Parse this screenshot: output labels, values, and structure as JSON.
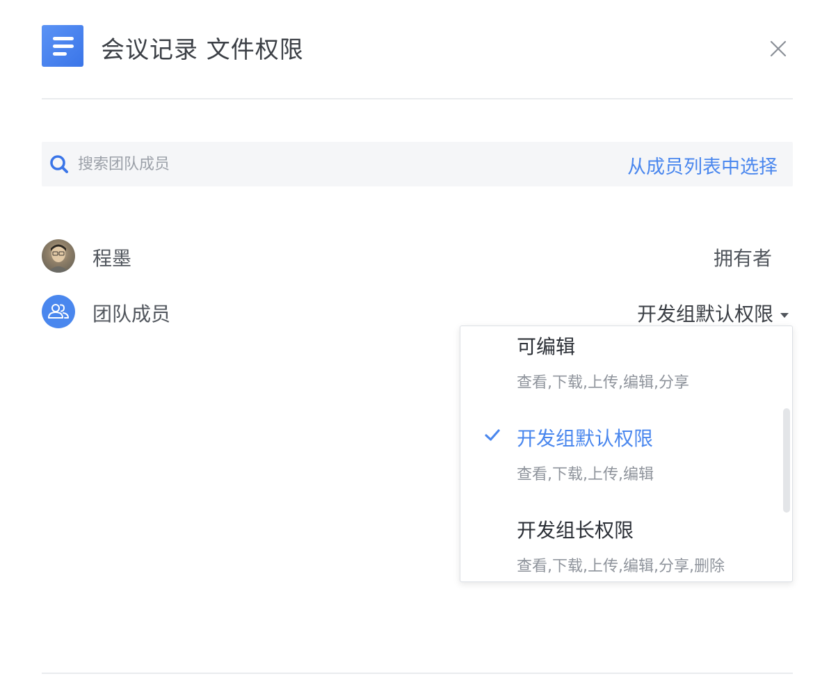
{
  "header": {
    "title": "会议记录 文件权限",
    "doc_icon": "document-icon",
    "close_icon": "close-icon"
  },
  "search": {
    "placeholder": "搜索团队成员",
    "value": "",
    "select_from_list_label": "从成员列表中选择",
    "icon": "search-icon"
  },
  "members": [
    {
      "name": "程墨",
      "role": "拥有者",
      "avatar": "photo"
    },
    {
      "name": "团队成员",
      "role": "开发组默认权限",
      "avatar": "group-icon"
    }
  ],
  "permission_menu": {
    "options": [
      {
        "label": "可编辑",
        "desc": "查看,下载,上传,编辑,分享",
        "selected": false
      },
      {
        "label": "开发组默认权限",
        "desc": "查看,下载,上传,编辑",
        "selected": true
      },
      {
        "label": "开发组长权限",
        "desc": "查看,下载,上传,编辑,分享,删除",
        "selected": false
      }
    ]
  },
  "colors": {
    "accent": "#4a87ee",
    "text_primary": "#2b2f36",
    "text_secondary": "#8e939b",
    "search_bg": "#f5f6f8",
    "divider": "#e9ebee"
  }
}
